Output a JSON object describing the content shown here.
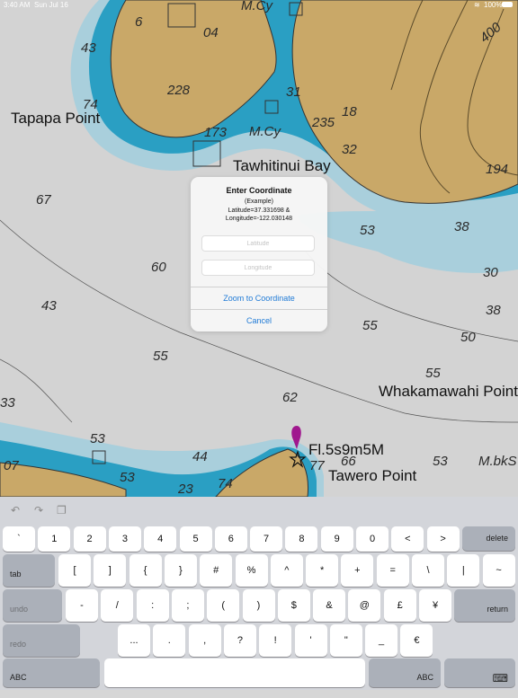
{
  "status_bar": {
    "time": "3:40 AM",
    "date": "Sun Jul 16",
    "battery": "100%"
  },
  "map": {
    "place_names": [
      {
        "id": "tapapa-point",
        "text": "Tapapa Point"
      },
      {
        "id": "tawhitinui-bay",
        "text": "Tawhitinui Bay"
      },
      {
        "id": "whakamawahi-point",
        "text": "Whakamawahi Point"
      },
      {
        "id": "tawero-point",
        "text": "Tawero Point"
      },
      {
        "id": "light-characteristic",
        "text": "Fl.5s9m5M"
      }
    ],
    "features": [
      "M.Cy",
      "M.Cy",
      "M.bkS"
    ],
    "depths": [
      "6",
      "04",
      "43",
      "228",
      "74",
      "31",
      "18",
      "235",
      "32",
      "173",
      "67",
      "194",
      "38",
      "53",
      "60",
      "30",
      "43",
      "55",
      "38",
      "50",
      "55",
      "55",
      "62",
      "33",
      "53",
      "44",
      "66",
      "53",
      "07",
      "53",
      "23",
      "74",
      "77",
      "400"
    ]
  },
  "dialog": {
    "title": "Enter Coordinate",
    "example_heading": "(Example)",
    "example_lat": "Latitude=37.331698 &",
    "example_lon": "Longitude=-122.030148",
    "latitude_placeholder": "Latitude",
    "longitude_placeholder": "Longitude",
    "zoom_button": "Zoom to Coordinate",
    "cancel_button": "Cancel"
  },
  "keyboard": {
    "row1": [
      "`",
      "1",
      "2",
      "3",
      "4",
      "5",
      "6",
      "7",
      "8",
      "9",
      "0",
      "<",
      ">"
    ],
    "delete": "delete",
    "tab": "tab",
    "row2": [
      "[",
      "]",
      "{",
      "}",
      "#",
      "%",
      "^",
      "*",
      "+",
      "=",
      "\\",
      "|",
      "~"
    ],
    "undo": "undo",
    "row3": [
      "-",
      "/",
      ":",
      ";",
      "(",
      ")",
      "$",
      "&",
      "@",
      "£",
      "¥"
    ],
    "return": "return",
    "redo": "redo",
    "row4": [
      "...",
      ".",
      ",",
      "?",
      "!",
      "'",
      "\"",
      "_",
      "€"
    ],
    "abc_left": "ABC",
    "abc_right": "ABC",
    "toolbar_icons": [
      "undo-icon",
      "redo-icon",
      "paste-icon"
    ],
    "dismiss_icon": "keyboard-dismiss-icon"
  },
  "colors": {
    "land": "#c9a868",
    "shallow_water": "#2a9fc3",
    "mid_water": "#a9cfdc",
    "deep_water": "#d3d3d3",
    "accent": "#1f7ad6",
    "pin": "#a0178e"
  }
}
